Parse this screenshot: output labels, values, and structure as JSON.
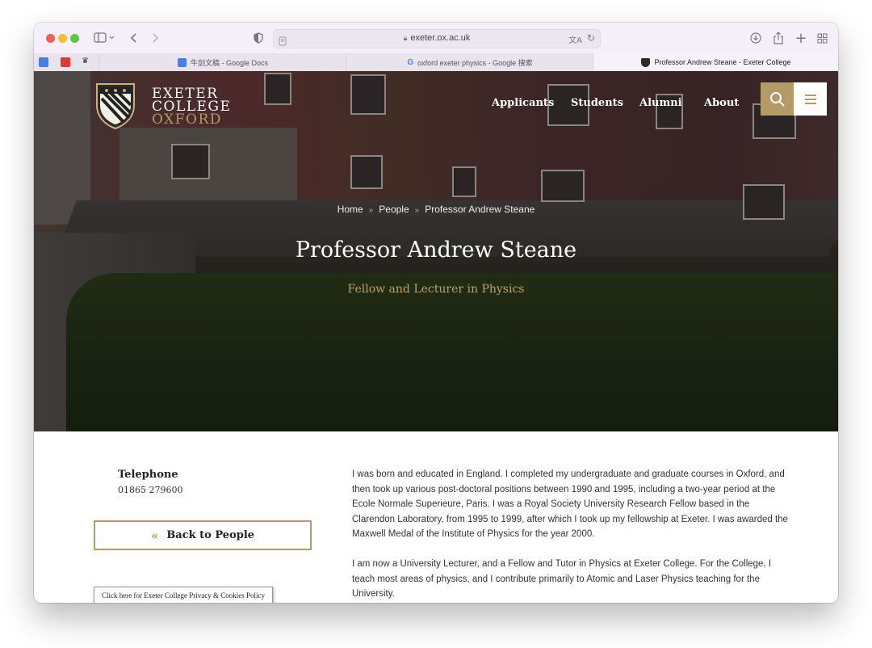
{
  "browser": {
    "address": "exeter.ox.ac.uk",
    "tabs": [
      {
        "label": "牛剑文稿 - Google Docs"
      },
      {
        "label": "oxford exeter physics - Google 搜索"
      },
      {
        "label": "Professor Andrew Steane - Exeter College"
      }
    ]
  },
  "site": {
    "logo_lines": [
      "EXETER",
      "COLLEGE",
      "OXFORD"
    ],
    "nav": [
      "Applicants",
      "Students",
      "Alumni",
      "About"
    ]
  },
  "hero": {
    "breadcrumb": [
      "Home",
      "People",
      "Professor Andrew Steane"
    ],
    "title": "Professor Andrew Steane",
    "subtitle": "Fellow and Lecturer in Physics"
  },
  "contact": {
    "telephone_label": "Telephone",
    "telephone": "01865 279600"
  },
  "back_button": "Back to People",
  "bio": [
    "I was born and educated in England. I completed my undergraduate and graduate courses in Oxford, and then took up various post-doctoral positions between 1990 and 1995, including a two-year period at the Ecole Normale Superieure, Paris. I was a Royal Society University Research Fellow based in the Clarendon Laboratory, from 1995 to 1999, after which I took up my fellowship at Exeter. I was awarded the Maxwell Medal of the Institute of Physics for the year 2000.",
    "I am now a University Lecturer, and a Fellow and Tutor in Physics at Exeter College. For the College, I teach most areas of physics, and I contribute primarily to Atomic and Laser Physics teaching for the University."
  ],
  "cookie_notice": "Click here for Exeter College Privacy & Cookies Policy",
  "colors": {
    "accent_gold": "#b39a68",
    "subtitle_gold": "#b9a468"
  }
}
